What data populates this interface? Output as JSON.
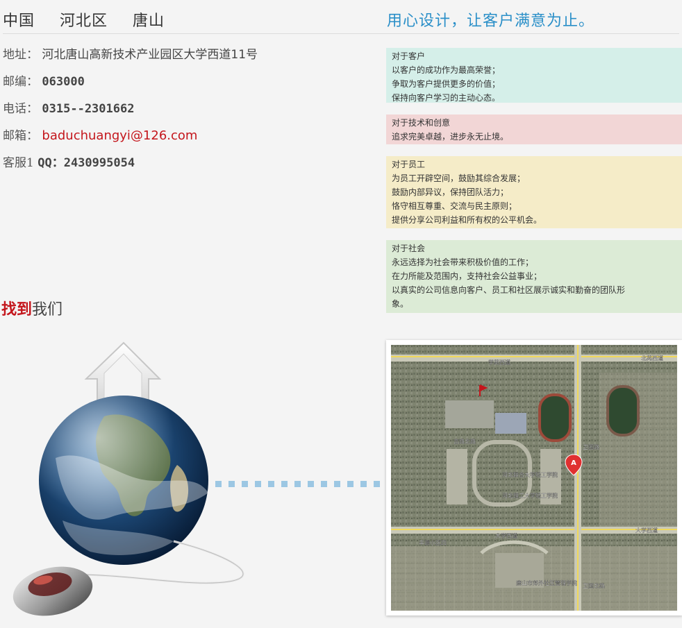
{
  "header": {
    "location": [
      "中国",
      "河北区",
      "唐山"
    ],
    "slogan": "用心设计，让客户满意为止。"
  },
  "contact": {
    "address_label": "地址：",
    "address_value": "河北唐山高新技术产业园区大学西道11号",
    "zip_label": "邮编：",
    "zip_value": "063000",
    "phone_label": "电话：",
    "phone_value": "0315--2301662",
    "email_label": "邮箱：",
    "email_value": "baduchuangyi@126.com",
    "service_label": "客服1",
    "service_value": "QQ：2430995054"
  },
  "findus": {
    "highlight": "找到",
    "rest": "我们"
  },
  "cards": [
    {
      "title": "对于客户",
      "lines": [
        "以客户的成功作为最高荣誉；",
        "争取为客户提供更多的价值；",
        "保持向客户学习的主动心态。"
      ]
    },
    {
      "title": "对于技术和创意",
      "lines": [
        "追求完美卓越，进步永无止境。"
      ]
    },
    {
      "title": "对于员工",
      "lines": [
        "为员工开辟空间，鼓励其综合发展；",
        "鼓励内部异议，保持团队活力；",
        "恪守相互尊重、交流与民主原则；",
        "提供分享公司利益和所有权的公平机会。"
      ]
    },
    {
      "title": "对于社会",
      "lines": [
        "永远选择为社会带来积极价值的工作；",
        "在力所能及范围内，支持社会公益事业；",
        "以真实的公司信息向客户、员工和社区展示诚实和勤奋的团队形",
        "象。"
      ]
    }
  ],
  "map": {
    "marker_letter": "A",
    "labels": [
      "学苑西道",
      "北苑西道",
      "吉路北路",
      "大学西道",
      "大学西道",
      "卫国路",
      "卫国北路",
      "河北联合大学轻工学院",
      "河北理工大学轻工学院",
      "丰源小区四",
      "唐山市郊外社区管理学院"
    ]
  },
  "colors": {
    "slogan": "#2a8fc8",
    "highlight": "#c4161c",
    "email": "#c4161c",
    "dots": "#9cc7e3"
  }
}
